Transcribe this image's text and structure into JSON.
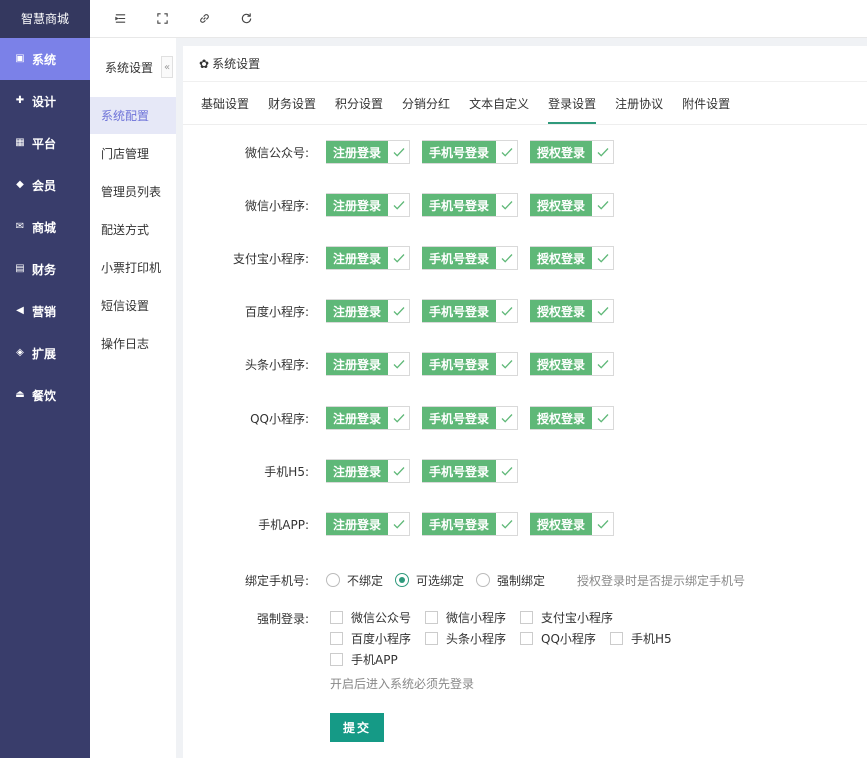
{
  "brand": "智慧商城",
  "sidebar": {
    "items": [
      {
        "label": "系统",
        "icon": "monitor-icon"
      },
      {
        "label": "设计",
        "icon": "puzzle-icon"
      },
      {
        "label": "平台",
        "icon": "grid-icon"
      },
      {
        "label": "会员",
        "icon": "gem-icon"
      },
      {
        "label": "商城",
        "icon": "mail-icon"
      },
      {
        "label": "财务",
        "icon": "wallet-icon"
      },
      {
        "label": "营销",
        "icon": "megaphone-icon"
      },
      {
        "label": "扩展",
        "icon": "cube-icon"
      },
      {
        "label": "餐饮",
        "icon": "eject-icon"
      }
    ],
    "active_index": 0
  },
  "subnav": {
    "title": "系统设置",
    "collapse_glyph": "«",
    "items": [
      "系统配置",
      "门店管理",
      "管理员列表",
      "配送方式",
      "小票打印机",
      "短信设置",
      "操作日志"
    ],
    "active_index": 0
  },
  "panel": {
    "title": "系统设置",
    "tabs": [
      "基础设置",
      "财务设置",
      "积分设置",
      "分销分红",
      "文本自定义",
      "登录设置",
      "注册协议",
      "附件设置"
    ],
    "active_tab": 5
  },
  "login_rows": [
    {
      "label": "微信公众号:",
      "options": [
        "注册登录",
        "手机号登录",
        "授权登录"
      ]
    },
    {
      "label": "微信小程序:",
      "options": [
        "注册登录",
        "手机号登录",
        "授权登录"
      ]
    },
    {
      "label": "支付宝小程序:",
      "options": [
        "注册登录",
        "手机号登录",
        "授权登录"
      ]
    },
    {
      "label": "百度小程序:",
      "options": [
        "注册登录",
        "手机号登录",
        "授权登录"
      ]
    },
    {
      "label": "头条小程序:",
      "options": [
        "注册登录",
        "手机号登录",
        "授权登录"
      ]
    },
    {
      "label": "QQ小程序:",
      "options": [
        "注册登录",
        "手机号登录",
        "授权登录"
      ]
    },
    {
      "label": "手机H5:",
      "options": [
        "注册登录",
        "手机号登录"
      ]
    },
    {
      "label": "手机APP:",
      "options": [
        "注册登录",
        "手机号登录",
        "授权登录"
      ]
    }
  ],
  "bind_phone": {
    "label": "绑定手机号:",
    "options": [
      "不绑定",
      "可选绑定",
      "强制绑定"
    ],
    "selected": 1,
    "hint": "授权登录时是否提示绑定手机号"
  },
  "force_login": {
    "label": "强制登录:",
    "options": [
      "微信公众号",
      "微信小程序",
      "支付宝小程序",
      "百度小程序",
      "头条小程序",
      "QQ小程序",
      "手机H5",
      "手机APP"
    ],
    "hint": "开启后进入系统必须先登录"
  },
  "submit_label": "提交",
  "colors": {
    "sidebar": "#393d6b",
    "active": "#7b81e8",
    "tag": "#5fb878",
    "primary": "#159a86"
  }
}
